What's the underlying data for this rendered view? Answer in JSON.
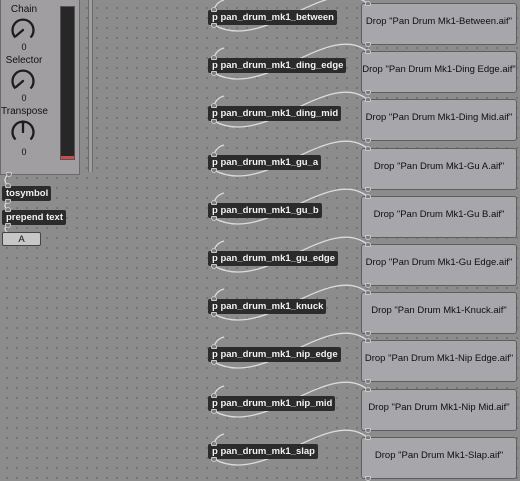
{
  "device": {
    "knobs": [
      {
        "label": "Chain",
        "value": "0"
      },
      {
        "label": "Selector",
        "value": "0"
      },
      {
        "label": "Transpose",
        "value": "0"
      }
    ],
    "meter_level": 0.02
  },
  "objects": {
    "tosymbol": "tosymbol",
    "prepend": "prepend text",
    "message": "A"
  },
  "rows": [
    {
      "subpatch": "p pan_drum_mk1_between",
      "drop": "Drop \"Pan Drum Mk1-Between.aif\""
    },
    {
      "subpatch": "p pan_drum_mk1_ding_edge",
      "drop": "Drop \"Pan Drum Mk1-Ding Edge.aif\""
    },
    {
      "subpatch": "p pan_drum_mk1_ding_mid",
      "drop": "Drop \"Pan Drum Mk1-Ding Mid.aif\""
    },
    {
      "subpatch": "p pan_drum_mk1_gu_a",
      "drop": "Drop \"Pan Drum Mk1-Gu A.aif\""
    },
    {
      "subpatch": "p pan_drum_mk1_gu_b",
      "drop": "Drop \"Pan Drum Mk1-Gu B.aif\""
    },
    {
      "subpatch": "p pan_drum_mk1_gu_edge",
      "drop": "Drop \"Pan Drum Mk1-Gu Edge.aif\""
    },
    {
      "subpatch": "p pan_drum_mk1_knuck",
      "drop": "Drop \"Pan Drum Mk1-Knuck.aif\""
    },
    {
      "subpatch": "p pan_drum_mk1_nip_edge",
      "drop": "Drop \"Pan Drum Mk1-Nip Edge.aif\""
    },
    {
      "subpatch": "p pan_drum_mk1_nip_mid",
      "drop": "Drop \"Pan Drum Mk1-Nip Mid.aif\""
    },
    {
      "subpatch": "p pan_drum_mk1_slap",
      "drop": "Drop \"Pan Drum Mk1-Slap.aif\""
    }
  ],
  "colors": {
    "canvas": "#8c8c8c",
    "object_fill": "#2b2b2b",
    "object_text": "#f2f2f2",
    "meter_accent": "#c94c52",
    "patch_cord": "#dcdcdc"
  }
}
